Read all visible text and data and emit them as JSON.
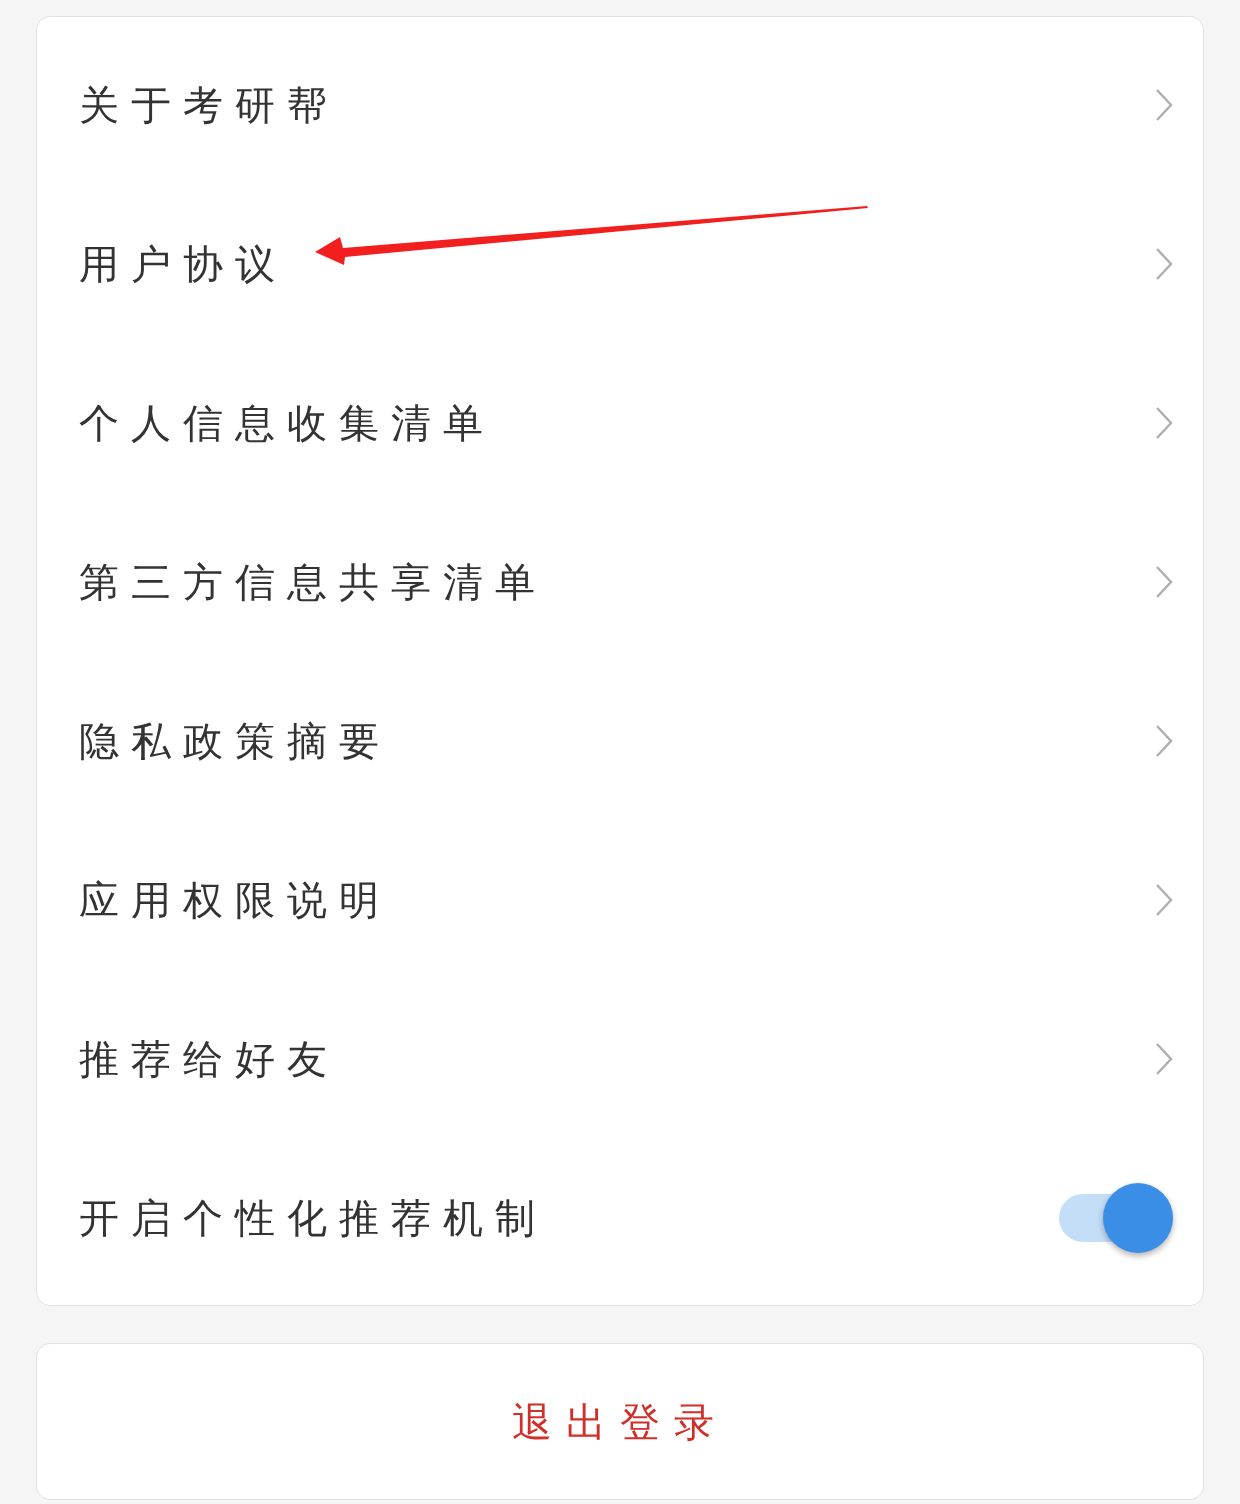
{
  "settings": [
    {
      "kind": "link",
      "label": "关于考研帮"
    },
    {
      "kind": "link",
      "label": "用户协议"
    },
    {
      "kind": "link",
      "label": "个人信息收集清单"
    },
    {
      "kind": "link",
      "label": "第三方信息共享清单"
    },
    {
      "kind": "link",
      "label": "隐私政策摘要"
    },
    {
      "kind": "link",
      "label": "应用权限说明"
    },
    {
      "kind": "link",
      "label": "推荐给好友"
    },
    {
      "kind": "toggle",
      "label": "开启个性化推荐机制",
      "on": true
    }
  ],
  "logout_button": {
    "label": "退出登录"
  }
}
